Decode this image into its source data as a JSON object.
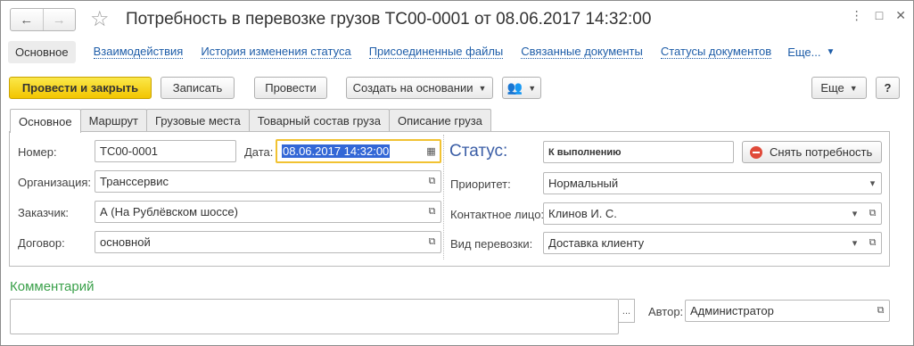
{
  "window": {
    "title": "Потребность в перевозке грузов ТС00-0001 от 08.06.2017 14:32:00",
    "back_icon": "←",
    "forward_icon": "→",
    "star_icon": "☆",
    "menu_icon": "⋮",
    "restore_icon": "□",
    "close_icon": "✕"
  },
  "link_tabs": {
    "active": "Основное",
    "items": [
      "Взаимодействия",
      "История изменения статуса",
      "Присоединенные файлы",
      "Связанные документы",
      "Статусы документов"
    ],
    "more": "Еще..."
  },
  "toolbar": {
    "post_close": "Провести и закрыть",
    "save": "Записать",
    "post": "Провести",
    "create_based": "Создать на основании",
    "more": "Еще",
    "help": "?"
  },
  "tabs": [
    "Основное",
    "Маршрут",
    "Грузовые места",
    "Товарный состав груза",
    "Описание груза"
  ],
  "form": {
    "number_label": "Номер:",
    "number_value": "ТС00-0001",
    "date_label": "Дата:",
    "date_value": "08.06.2017 14:32:00",
    "org_label": "Организация:",
    "org_value": "Транссервис",
    "customer_label": "Заказчик:",
    "customer_value": "А (На Рублёвском шоссе)",
    "contract_label": "Договор:",
    "contract_value": "основной",
    "status_label": "Статус:",
    "status_value": "К выполнению",
    "cancel_need": "Снять потребность",
    "priority_label": "Приоритет:",
    "priority_value": "Нормальный",
    "contact_label": "Контактное лицо:",
    "contact_value": "Клинов И. С.",
    "transport_label": "Вид перевозки:",
    "transport_value": "Доставка клиенту"
  },
  "comment": {
    "heading": "Комментарий",
    "value": "",
    "author_label": "Автор:",
    "author_value": "Администратор"
  }
}
